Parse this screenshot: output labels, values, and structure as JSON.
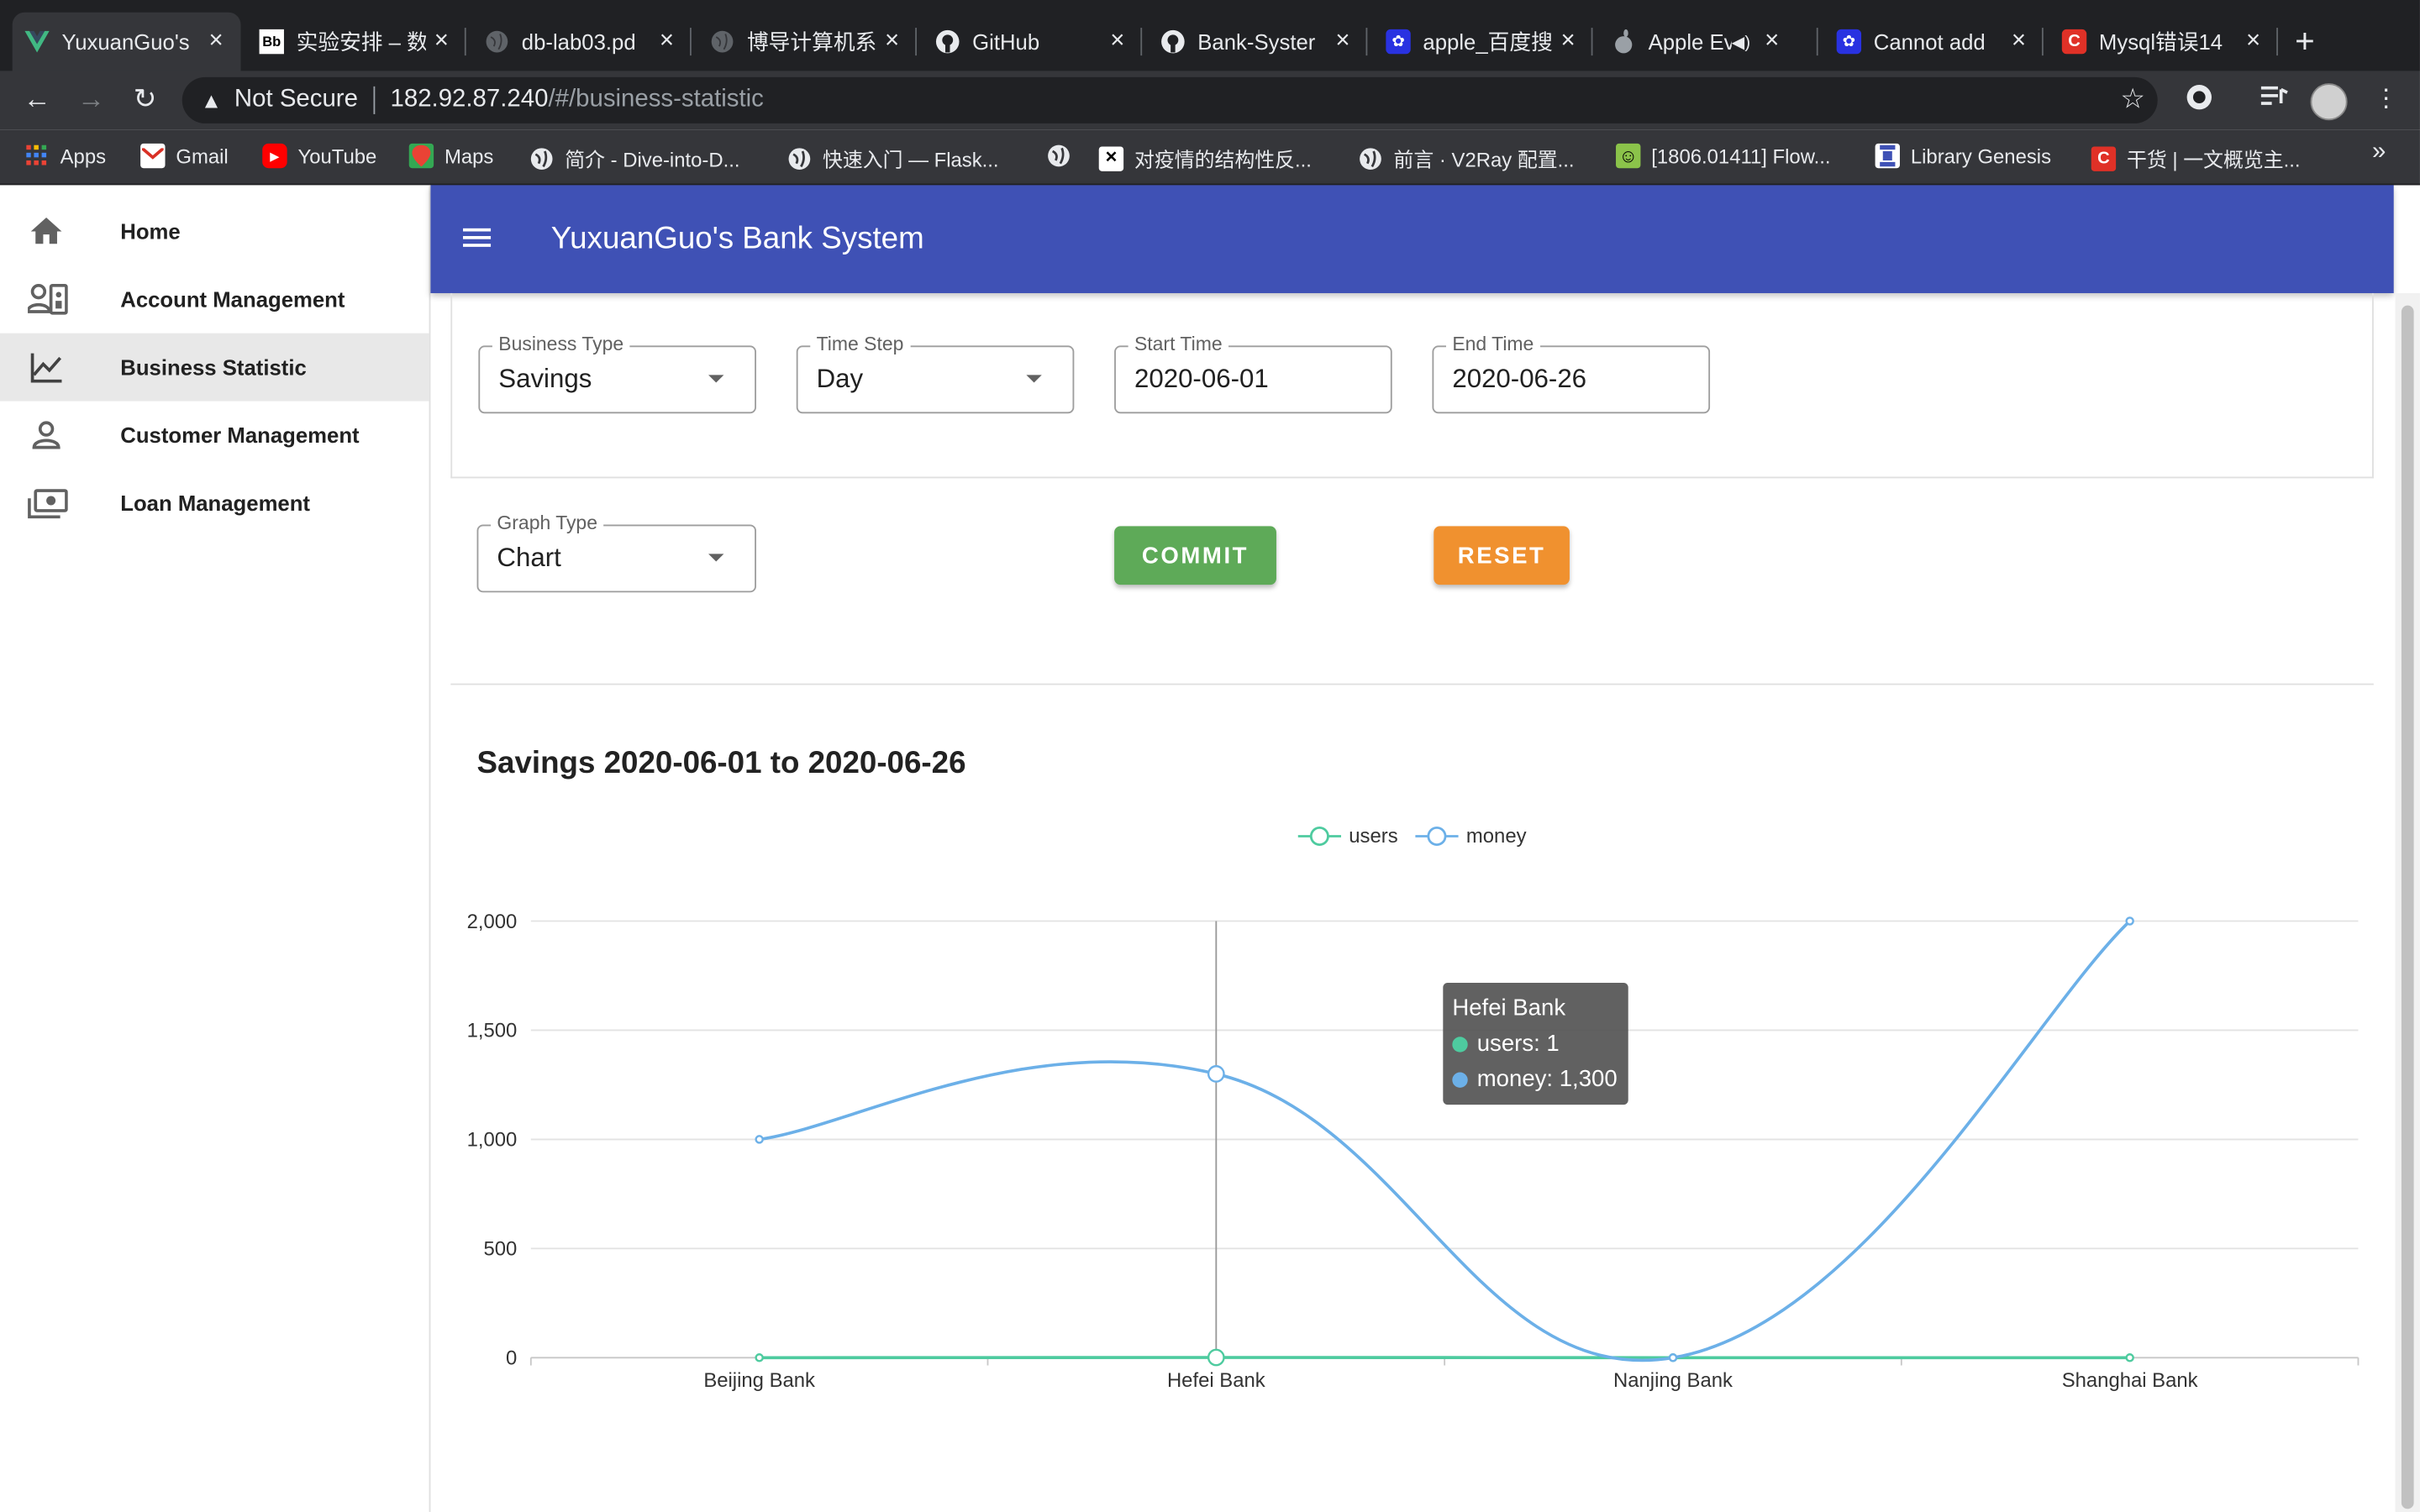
{
  "browser": {
    "tabs": [
      {
        "title": "YuxuanGuo's",
        "active": true
      },
      {
        "title": "实验安排 – 数"
      },
      {
        "title": "db-lab03.pd"
      },
      {
        "title": "博导计算机系"
      },
      {
        "title": "GitHub"
      },
      {
        "title": "Bank-Syster"
      },
      {
        "title": "apple_百度搜"
      },
      {
        "title": "Apple Ev"
      },
      {
        "title": "Cannot add"
      },
      {
        "title": "Mysql错误14"
      }
    ],
    "security_label": "Not Secure",
    "url_host": "182.92.87.240",
    "url_path": "/#/business-statistic",
    "bookmarks": [
      {
        "label": "Apps"
      },
      {
        "label": "Gmail"
      },
      {
        "label": "YouTube"
      },
      {
        "label": "Maps"
      },
      {
        "label": "简介 - Dive-into-D..."
      },
      {
        "label": "快速入门 — Flask..."
      },
      {
        "label": ""
      },
      {
        "label": "对疫情的结构性反..."
      },
      {
        "label": "前言 · V2Ray 配置..."
      },
      {
        "label": "[1806.01411] Flow..."
      },
      {
        "label": "Library Genesis"
      },
      {
        "label": "干货 | 一文概览主..."
      }
    ],
    "more_bookmarks": "»"
  },
  "app": {
    "title": "YuxuanGuo's Bank System",
    "nav": [
      {
        "label": "Home",
        "icon": "home-icon"
      },
      {
        "label": "Account Management",
        "icon": "account-management-icon"
      },
      {
        "label": "Business Statistic",
        "icon": "chart-line-icon",
        "active": true
      },
      {
        "label": "Customer Management",
        "icon": "person-icon"
      },
      {
        "label": "Loan Management",
        "icon": "cash-icon"
      }
    ]
  },
  "form": {
    "business_type": {
      "label": "Business Type",
      "value": "Savings"
    },
    "time_step": {
      "label": "Time Step",
      "value": "Day"
    },
    "start_time": {
      "label": "Start Time",
      "value": "2020-06-01"
    },
    "end_time": {
      "label": "End Time",
      "value": "2020-06-26"
    },
    "graph_type": {
      "label": "Graph Type",
      "value": "Chart"
    },
    "commit_label": "COMMIT",
    "reset_label": "RESET"
  },
  "colors": {
    "appbar": "#3f51b5",
    "commit": "#5eaa58",
    "reset": "#f0912f",
    "users_series": "#4ecb9f",
    "money_series": "#6cb0e8"
  },
  "chart_data": {
    "type": "line",
    "title": "Savings 2020-06-01 to 2020-06-26",
    "categories": [
      "Beijing Bank",
      "Hefei Bank",
      "Nanjing Bank",
      "Shanghai Bank"
    ],
    "series": [
      {
        "name": "users",
        "values": [
          0,
          1,
          0,
          0
        ]
      },
      {
        "name": "money",
        "values": [
          1000,
          1300,
          0,
          2000
        ]
      }
    ],
    "y_ticks": [
      "0",
      "500",
      "1,000",
      "1,500",
      "2,000"
    ],
    "ylim": [
      0,
      2000
    ],
    "smooth": true,
    "grid": true,
    "legend_position": "top-center",
    "tooltip": {
      "title": "Hefei Bank",
      "users_text": "users: 1",
      "money_text": "money: 1,300"
    }
  }
}
